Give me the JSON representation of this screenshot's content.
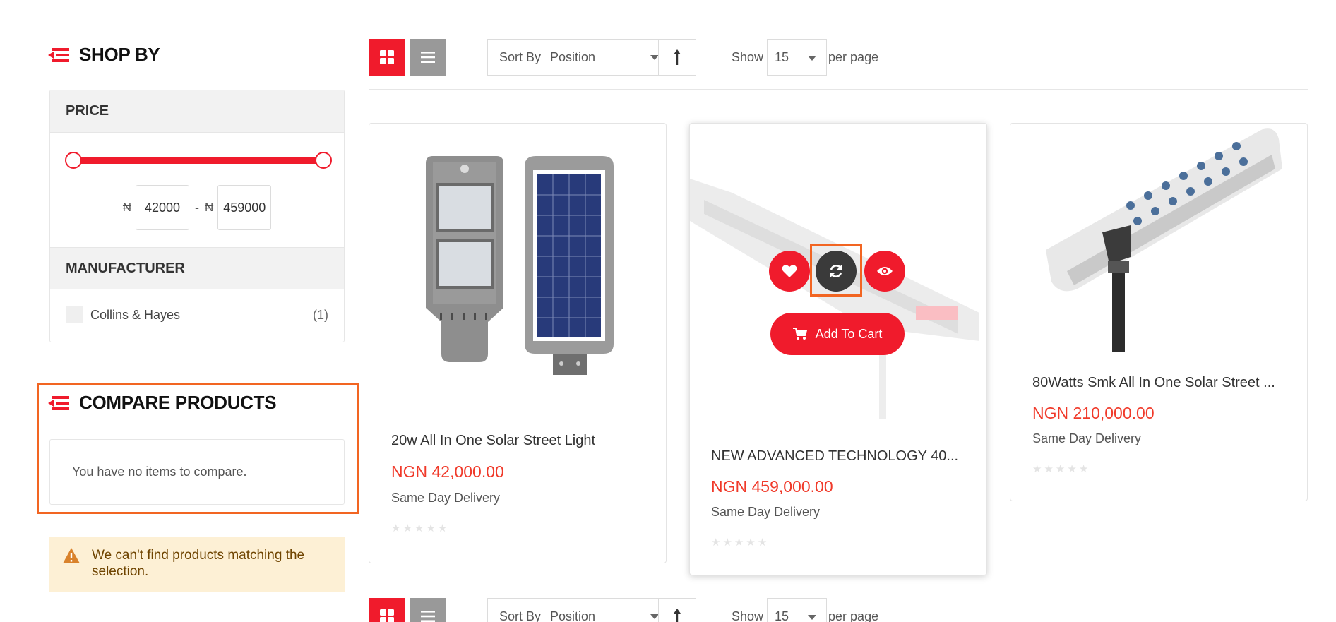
{
  "sidebar": {
    "shop_by_title": "SHOP BY",
    "price": {
      "heading": "PRICE",
      "currency_symbol": "₦",
      "min": "42000",
      "max": "459000",
      "separator": "-"
    },
    "manufacturer": {
      "heading": "MANUFACTURER",
      "items": [
        {
          "label": "Collins & Hayes",
          "count": "(1)"
        }
      ]
    },
    "compare": {
      "title": "COMPARE PRODUCTS",
      "empty_text": "You have no items to compare."
    },
    "notice": "We can't find products matching the selection."
  },
  "toolbar": {
    "sort_label": "Sort By",
    "sort_value": "Position",
    "show_label": "Show",
    "limit_value": "15",
    "per_page": "per page"
  },
  "products": [
    {
      "name": "20w All In One Solar Street Light",
      "price": "NGN 42,000.00",
      "shipping": "Same Day Delivery",
      "rating_stars": 0
    },
    {
      "name": "NEW ADVANCED TECHNOLOGY 40...",
      "price": "NGN 459,000.00",
      "shipping": "Same Day Delivery",
      "rating_stars": 0,
      "add_to_cart": "Add To Cart"
    },
    {
      "name": "80Watts Smk All In One Solar Street ...",
      "price": "NGN 210,000.00",
      "shipping": "Same Day Delivery",
      "rating_stars": 0
    }
  ],
  "colors": {
    "accent": "#f01b2c",
    "price": "#f03a2a",
    "highlight": "#f26522",
    "notice_bg": "#fdf0d5"
  }
}
